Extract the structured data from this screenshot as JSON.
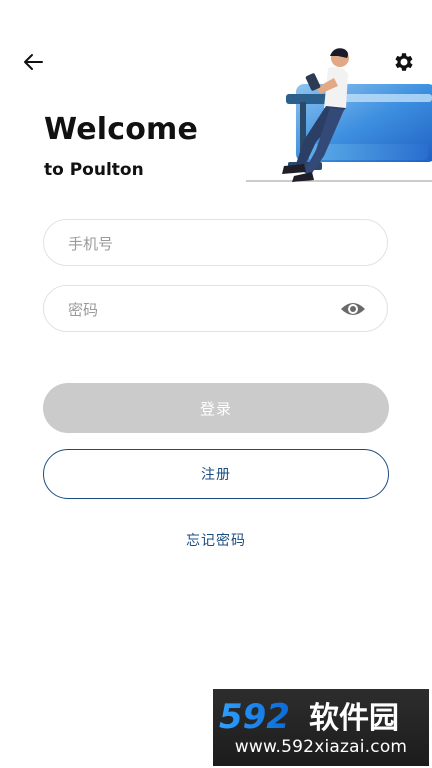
{
  "header": {
    "back_icon": "arrow-left-icon",
    "settings_icon": "gear-icon"
  },
  "welcome": {
    "title": "Welcome",
    "subtitle": "to Poulton"
  },
  "form": {
    "phone_placeholder": "手机号",
    "password_placeholder": "密码",
    "password_toggle_icon": "eye-icon"
  },
  "actions": {
    "login_label": "登录",
    "register_label": "注册",
    "forgot_label": "忘记密码"
  },
  "watermark": {
    "brand": "592软件园",
    "url": "www.592xiazai.com"
  },
  "colors": {
    "accent": "#1c4d80",
    "login_disabled": "#cbcbcb",
    "field_border": "#e2e2e2"
  }
}
